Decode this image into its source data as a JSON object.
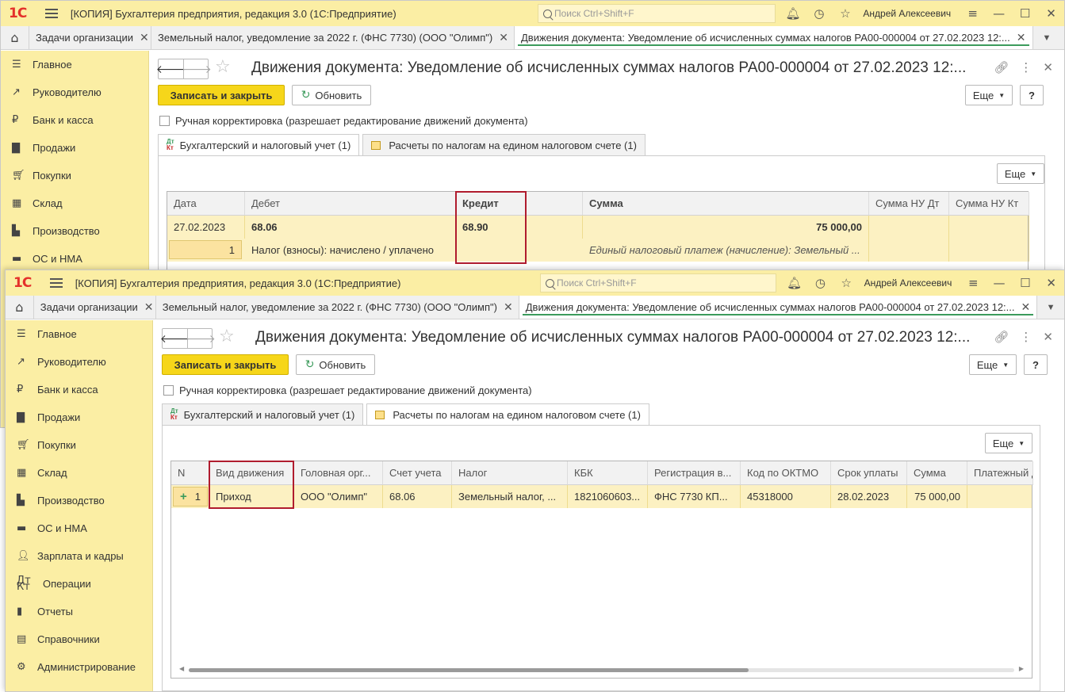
{
  "app": {
    "title": "[КОПИЯ] Бухгалтерия предприятия, редакция 3.0  (1С:Предприятие)",
    "search_placeholder": "Поиск Ctrl+Shift+F",
    "user": "Андрей Алексеевич",
    "logo": "1С"
  },
  "open_tabs": [
    {
      "label": "Задачи организации"
    },
    {
      "label": "Земельный налог, уведомление за 2022 г. (ФНС 7730) (ООО \"Олимп\")"
    },
    {
      "label": "Движения документа: Уведомление об исчисленных суммах налогов РА00-000004 от 27.02.2023 12:..."
    }
  ],
  "sidebar": {
    "items": [
      {
        "label": "Главное",
        "icon": "menu-lines-icon"
      },
      {
        "label": "Руководителю",
        "icon": "trend-icon"
      },
      {
        "label": "Банк и касса",
        "icon": "ruble-coin-icon"
      },
      {
        "label": "Продажи",
        "icon": "shopping-bag-icon"
      },
      {
        "label": "Покупки",
        "icon": "cart-icon"
      },
      {
        "label": "Склад",
        "icon": "warehouse-grid-icon"
      },
      {
        "label": "Производство",
        "icon": "factory-icon"
      },
      {
        "label": "ОС и НМА",
        "icon": "truck-icon"
      },
      {
        "label": "Зарплата и кадры",
        "icon": "person-icon"
      },
      {
        "label": "Операции",
        "icon": "dt-kt-icon"
      },
      {
        "label": "Отчеты",
        "icon": "bar-chart-icon"
      },
      {
        "label": "Справочники",
        "icon": "books-icon"
      },
      {
        "label": "Администрирование",
        "icon": "gear-icon"
      }
    ]
  },
  "form": {
    "title": "Движения документа: Уведомление об исчисленных суммах налогов РА00-000004 от 27.02.2023 12:...",
    "save_close": "Записать и закрыть",
    "refresh": "Обновить",
    "more": "Еще",
    "help": "?",
    "manual_edit": "Ручная корректировка (разрешает редактирование движений документа)",
    "tab_accounting": "Бухгалтерский и налоговый учет (1)",
    "tab_ens": "Расчеты по налогам на едином налоговом счете (1)",
    "dt": "Дт",
    "kt": "Кт"
  },
  "accounting_table": {
    "headers": {
      "date": "Дата",
      "debit": "Дебет",
      "credit": "Кредит",
      "sum": "Сумма",
      "sum_nu_dt": "Сумма НУ Дт",
      "sum_nu_kt": "Сумма НУ Кт"
    },
    "row": {
      "date": "27.02.2023",
      "number": "1",
      "debit": "68.06",
      "debit_desc": "Налог (взносы): начислено / уплачено",
      "credit": "68.90",
      "sum": "75 000,00",
      "content": "Единый налоговый платеж (начисление): Земельный ..."
    }
  },
  "ens_table": {
    "headers": {
      "n": "N",
      "kind": "Вид движения",
      "org": "Головная орг...",
      "account": "Счет учета",
      "tax": "Налог",
      "kbk": "КБК",
      "reg": "Регистрация в...",
      "oktmo": "Код по ОКТМО",
      "due": "Срок уплаты",
      "sum": "Сумма",
      "payment": "Платежный д..."
    },
    "row": {
      "sign": "+",
      "n": "1",
      "kind": "Приход",
      "org": "ООО \"Олимп\"",
      "account": "68.06",
      "tax": "Земельный налог, ...",
      "kbk": "1821060603...",
      "reg": "ФНС 7730 КП...",
      "oktmo": "45318000",
      "due": "28.02.2023",
      "sum": "75 000,00"
    }
  }
}
